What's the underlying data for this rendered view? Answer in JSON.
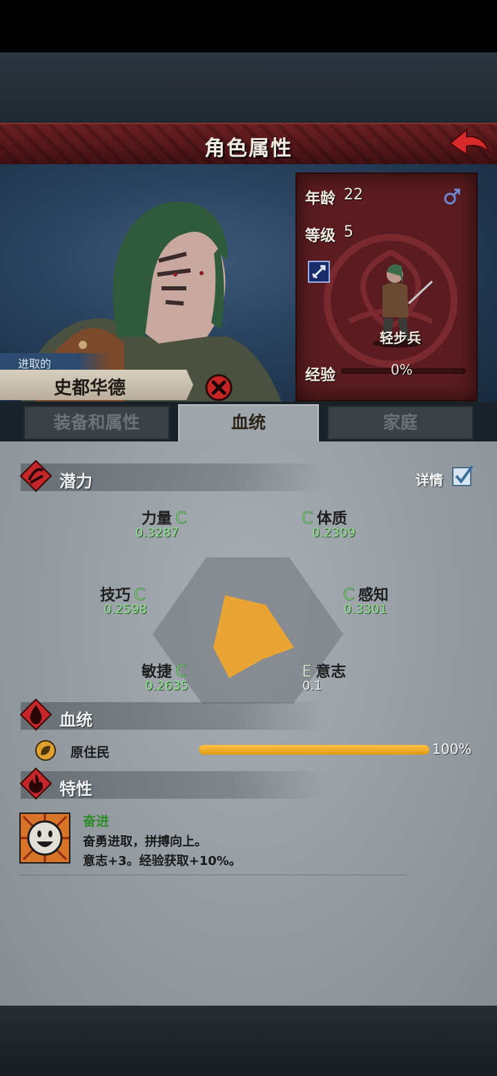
{
  "header": {
    "title": "角色属性"
  },
  "character": {
    "trait_tag": "进取的",
    "name": "史都华德",
    "age_label": "年龄",
    "age": "22",
    "level_label": "等级",
    "level": "5",
    "class_name": "轻步兵",
    "exp_label": "经验",
    "exp_percent": "0%",
    "exp_fraction": 0
  },
  "tabs": [
    {
      "label": "装备和属性",
      "active": false
    },
    {
      "label": "血统",
      "active": true
    },
    {
      "label": "家庭",
      "active": false
    }
  ],
  "potential": {
    "title": "潜力",
    "details_label": "详情",
    "details_checked": true,
    "stats": [
      {
        "name": "力量",
        "grade": "C",
        "value": "0.3287"
      },
      {
        "name": "体质",
        "grade": "C",
        "value": "0.2309"
      },
      {
        "name": "感知",
        "grade": "C",
        "value": "0.3301"
      },
      {
        "name": "意志",
        "grade": "E",
        "value": "0.1"
      },
      {
        "name": "敏捷",
        "grade": "C",
        "value": "0.2635"
      },
      {
        "name": "技巧",
        "grade": "C",
        "value": "0.2598"
      }
    ],
    "fill_color": "#e8a534"
  },
  "bloodline": {
    "title": "血统",
    "entries": [
      {
        "name": "原住民",
        "percent": "100%",
        "fraction": 1.0
      }
    ]
  },
  "traits": {
    "title": "特性",
    "items": [
      {
        "name": "奋进",
        "description": "奋勇进取，拼搏向上。",
        "effect": "意志+3。经验获取+10%。"
      }
    ]
  },
  "colors": {
    "title_red": "#5a1a1d",
    "accent_orange": "#e8a534",
    "grade_green": "#7fd07a"
  }
}
